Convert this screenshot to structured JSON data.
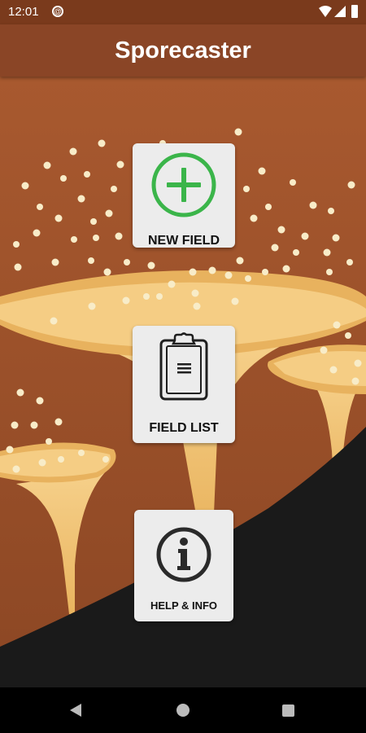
{
  "status_bar": {
    "time": "12:01"
  },
  "app": {
    "title": "Sporecaster"
  },
  "menu": {
    "new_field": {
      "label": "NEW FIELD",
      "icon": "plus-circle-icon",
      "accent": "#3bb54a"
    },
    "field_list": {
      "label": "FIELD LIST",
      "icon": "clipboard-icon"
    },
    "help_info": {
      "label": "HELP & INFO",
      "icon": "info-circle-icon"
    }
  },
  "colors": {
    "app_bar": "#8a4526",
    "status_bar": "#7a3a1c",
    "background": "#9e5530",
    "mushroom": "#f0c473",
    "ground": "#1a1a1a",
    "tile": "#ececec"
  },
  "nav_bar": {
    "back": "back-icon",
    "home": "home-icon",
    "recents": "recents-icon"
  }
}
